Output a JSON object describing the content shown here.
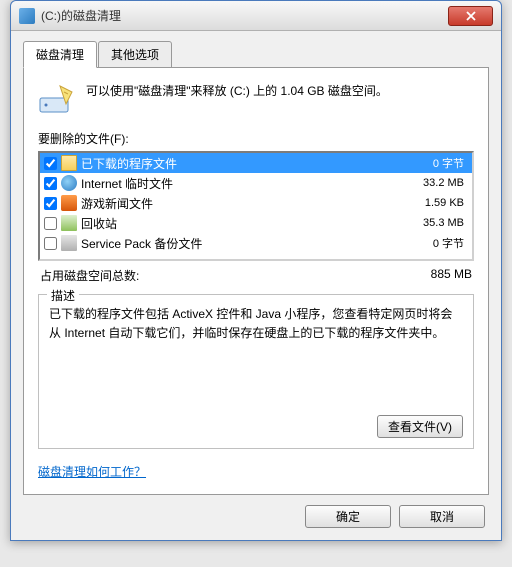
{
  "window": {
    "title": "(C:)的磁盘清理"
  },
  "tabs": {
    "cleanup": "磁盘清理",
    "other": "其他选项"
  },
  "intro": "可以使用\"磁盘清理\"来释放  (C:) 上的 1.04 GB 磁盘空间。",
  "files_label": "要删除的文件(F):",
  "files": [
    {
      "checked": true,
      "icon": "folder",
      "name": "已下载的程序文件",
      "size": "0 字节"
    },
    {
      "checked": true,
      "icon": "ie",
      "name": "Internet 临时文件",
      "size": "33.2 MB"
    },
    {
      "checked": true,
      "icon": "game",
      "name": "游戏新闻文件",
      "size": "1.59 KB"
    },
    {
      "checked": false,
      "icon": "recycle",
      "name": "回收站",
      "size": "35.3 MB"
    },
    {
      "checked": false,
      "icon": "sp",
      "name": "Service Pack 备份文件",
      "size": "0 字节"
    }
  ],
  "total": {
    "label": "占用磁盘空间总数:",
    "value": "885 MB"
  },
  "description": {
    "title": "描述",
    "text": "已下载的程序文件包括 ActiveX 控件和 Java 小程序，您查看特定网页时将会从 Internet 自动下载它们，并临时保存在硬盘上的已下载的程序文件夹中。",
    "view_button": "查看文件(V)"
  },
  "help_link": "磁盘清理如何工作？",
  "buttons": {
    "ok": "确定",
    "cancel": "取消"
  }
}
